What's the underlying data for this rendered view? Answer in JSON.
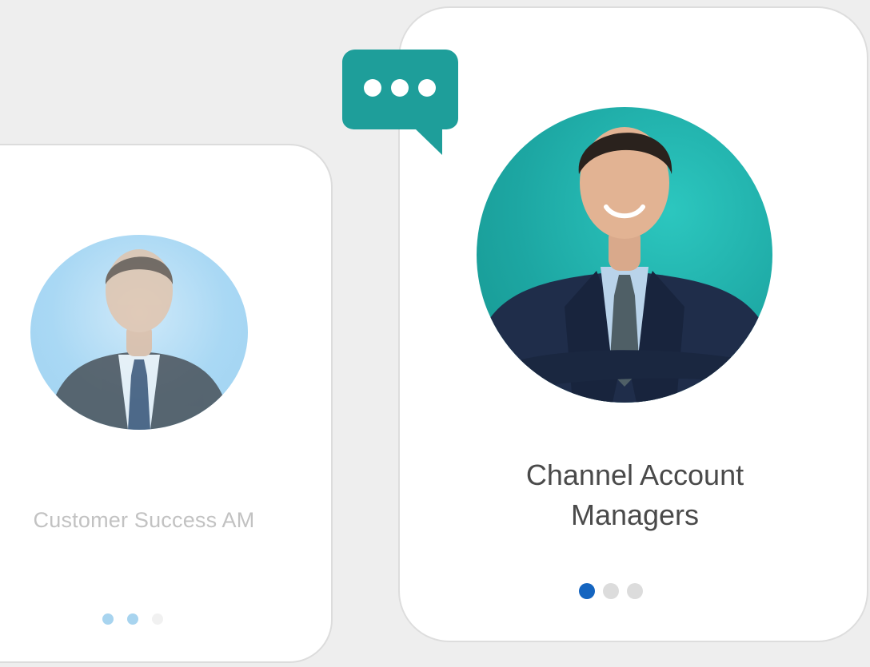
{
  "cards": {
    "back": {
      "name": "Customer Success AM",
      "dots_active": [
        true,
        true,
        false
      ]
    },
    "front": {
      "name_line1": "Channel Account",
      "name_line2": "Managers",
      "dots_active": [
        true,
        false,
        false
      ]
    }
  },
  "chat_bubble": {
    "icon": "chat-dots-icon"
  },
  "colors": {
    "teal": "#1e9e9a",
    "front_circle": "#1da7a3",
    "back_circle": "#a9d8f4",
    "active_dot": "#1565c0",
    "faded_dot": "#a8d4ef",
    "inactive_dot": "#dcdcdc",
    "suit_navy": "#1f2d4a",
    "suit_dark": "#2b2f36"
  }
}
